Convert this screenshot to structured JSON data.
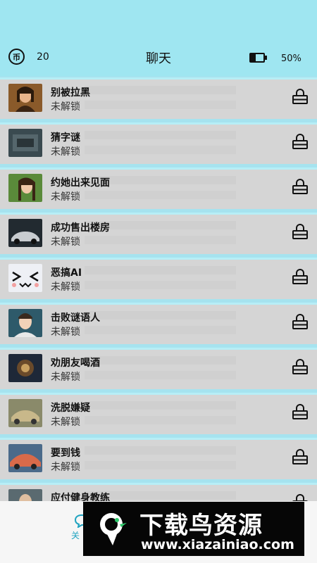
{
  "header": {
    "coin_icon_text": "币",
    "coin_count": "20",
    "title": "聊天",
    "battery_percent": "50%",
    "battery_level": 0.5
  },
  "chats": [
    {
      "title": "别被拉黑",
      "status": "未解锁",
      "thumb": "portrait-girl"
    },
    {
      "title": "猜字谜",
      "status": "未解锁",
      "thumb": "dark-scene"
    },
    {
      "title": "约她出来见面",
      "status": "未解锁",
      "thumb": "portrait-girl-green"
    },
    {
      "title": "成功售出楼房",
      "status": "未解锁",
      "thumb": "car"
    },
    {
      "title": "恶搞AI",
      "status": "未解锁",
      "thumb": "emoji-face"
    },
    {
      "title": "击败谜语人",
      "status": "未解锁",
      "thumb": "portrait-boy"
    },
    {
      "title": "劝朋友喝酒",
      "status": "未解锁",
      "thumb": "dark-drink"
    },
    {
      "title": "洗脱嫌疑",
      "status": "未解锁",
      "thumb": "vintage-car"
    },
    {
      "title": "要到钱",
      "status": "未解锁",
      "thumb": "sports-car"
    },
    {
      "title": "应付健身教练",
      "status": "",
      "thumb": "portrait"
    }
  ],
  "bottom_nav": {
    "label": "关"
  },
  "watermark": {
    "logo_text": "下",
    "main_text": "下载鸟资源",
    "sub_text": "www.xiazainiao.com"
  },
  "icons": {
    "lock": "lock-icon",
    "coin": "coin-icon",
    "battery": "battery-icon",
    "chat": "chat-bubble-icon"
  },
  "colors": {
    "header_bg": "#9fe6f1",
    "row_bg": "#d5d5d5",
    "accent": "#1fa3c0"
  }
}
